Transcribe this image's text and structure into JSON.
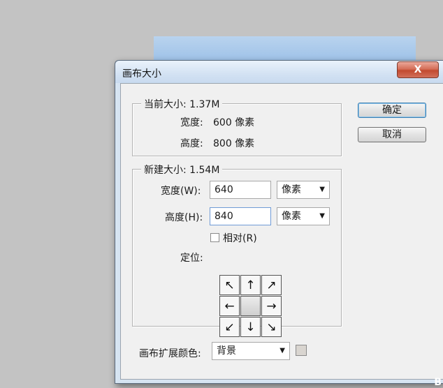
{
  "dialog": {
    "title": "画布大小",
    "close_label": "X"
  },
  "current_size": {
    "legend": "当前大小: 1.37M",
    "width_label": "宽度:",
    "width_value": "600 像素",
    "height_label": "高度:",
    "height_value": "800 像素"
  },
  "new_size": {
    "legend": "新建大小: 1.54M",
    "width_label": "宽度(W):",
    "width_value": "640",
    "width_unit": "像素",
    "height_label": "高度(H):",
    "height_value": "840",
    "height_unit": "像素",
    "relative_label": "相对(R)",
    "relative_checked": false,
    "anchor_label": "定位:",
    "anchor_arrows": [
      "↖",
      "↑",
      "↗",
      "←",
      "",
      "→",
      "↙",
      "↓",
      "↘"
    ]
  },
  "extension": {
    "label": "画布扩展颜色:",
    "value": "背景",
    "swatch_color": "#d9d5d0"
  },
  "buttons": {
    "ok": "确定",
    "cancel": "取消"
  },
  "corner_mark": "B"
}
